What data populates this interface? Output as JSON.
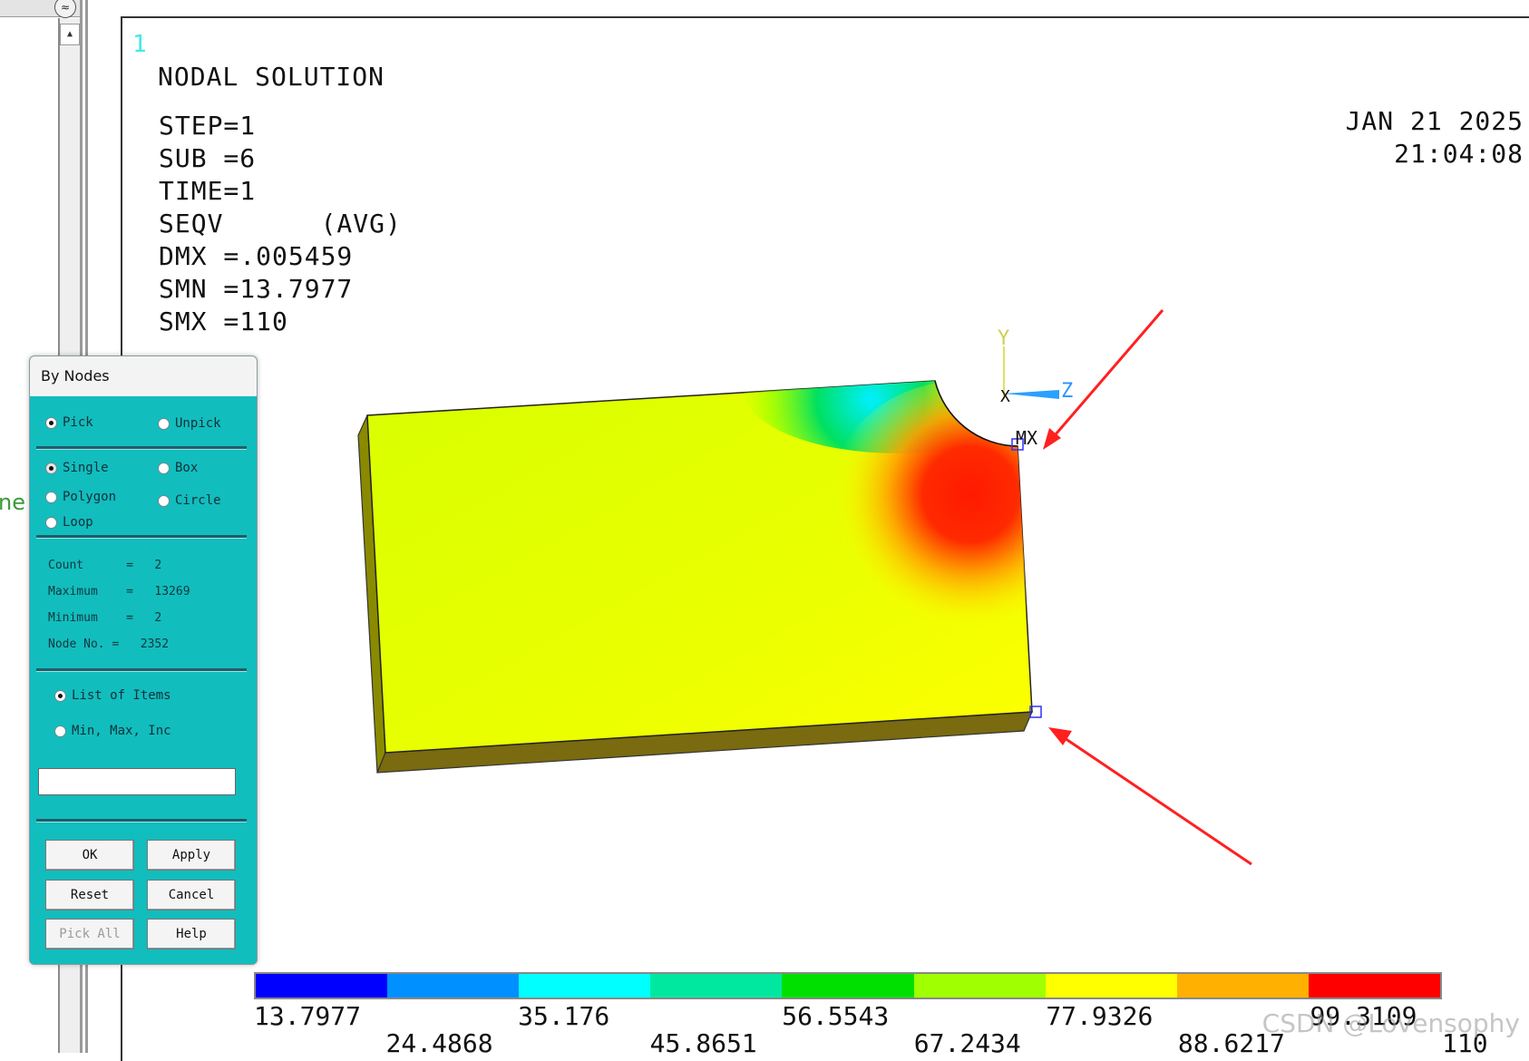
{
  "gutter": {
    "collapse_glyph": "≈",
    "scroll_up_glyph": "▲",
    "fragment_text": "ne"
  },
  "graphics": {
    "window_number": "1",
    "title": "NODAL SOLUTION",
    "info": {
      "step": "STEP=1",
      "sub": "SUB =6",
      "time": "TIME=1",
      "item": "SEQV      (AVG)",
      "dmx": "DMX =.005459",
      "smn": "SMN =13.7977",
      "smx": "SMX =110"
    },
    "date": "JAN 21 2025",
    "clock": "21:04:08",
    "triad": {
      "y_label": "Y",
      "z_label": "Z",
      "x_label": "X"
    },
    "mx_label": "MX"
  },
  "dialog": {
    "title": "By Nodes",
    "pick_label": "Pick",
    "unpick_label": "Unpick",
    "single_label": "Single",
    "box_label": "Box",
    "polygon_label": "Polygon",
    "circle_label": "Circle",
    "loop_label": "Loop",
    "count_line": "Count      =   2",
    "maximum_line": "Maximum    =   13269",
    "minimum_line": "Minimum    =   2",
    "nodeno_line": "Node No. =   2352",
    "list_items_label": "List of Items",
    "min_max_inc_label": "Min, Max, Inc",
    "input_value": "",
    "ok_label": "OK",
    "apply_label": "Apply",
    "reset_label": "Reset",
    "cancel_label": "Cancel",
    "pick_all_label": "Pick All",
    "help_label": "Help"
  },
  "legend": {
    "colors": [
      "#0000ff",
      "#0090ff",
      "#00ffff",
      "#00e8a0",
      "#00e000",
      "#a0ff00",
      "#ffff00",
      "#ffb000",
      "#ff0000"
    ],
    "upper_levels": [
      "13.7977",
      "35.176",
      "56.5543",
      "77.9326",
      "99.3109"
    ],
    "lower_levels": [
      "24.4868",
      "45.8651",
      "67.2434",
      "88.6217",
      "110"
    ]
  },
  "watermark": "CSDN @Lovensophy",
  "colors": {
    "dialog_bg": "#12bdbd",
    "arrow": "#ff2020",
    "model_face": "#e6ff00",
    "model_side": "#7a7a00",
    "hotspot": "#ff1a00"
  }
}
